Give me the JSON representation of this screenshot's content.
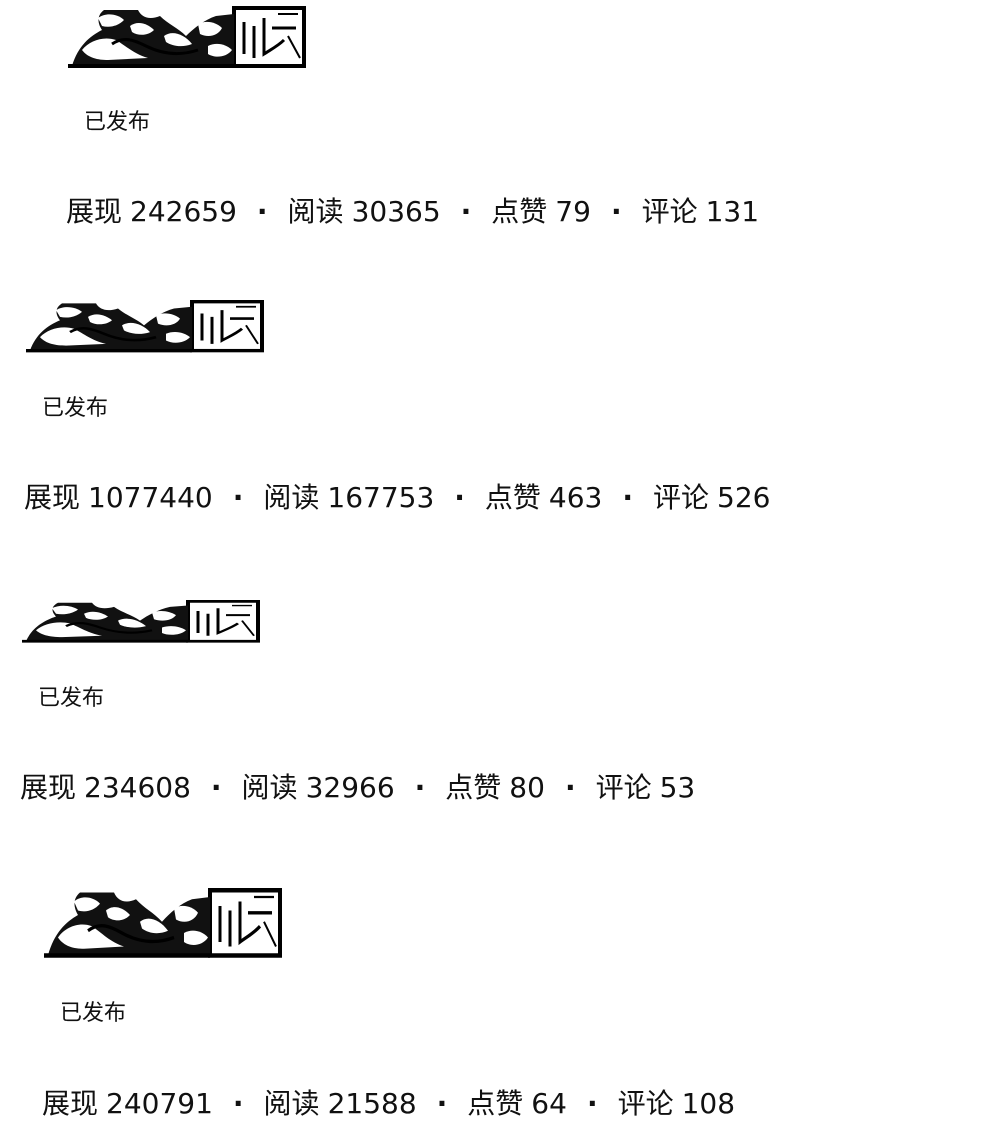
{
  "status_color": "#111111",
  "labels": {
    "impressions": "展现",
    "reads": "阅读",
    "likes": "点赞",
    "comments": "评论",
    "separator": "·"
  },
  "articles": [
    {
      "thumbnail": "calligraphy-thumbnail",
      "status": "已发布",
      "impressions": "242659",
      "reads": "30365",
      "likes": "79",
      "comments": "131"
    },
    {
      "thumbnail": "calligraphy-thumbnail",
      "status": "已发布",
      "impressions": "1077440",
      "reads": "167753",
      "likes": "463",
      "comments": "526"
    },
    {
      "thumbnail": "calligraphy-thumbnail",
      "status": "已发布",
      "impressions": "234608",
      "reads": "32966",
      "likes": "80",
      "comments": "53"
    },
    {
      "thumbnail": "calligraphy-thumbnail",
      "status": "已发布",
      "impressions": "240791",
      "reads": "21588",
      "likes": "64",
      "comments": "108"
    }
  ]
}
